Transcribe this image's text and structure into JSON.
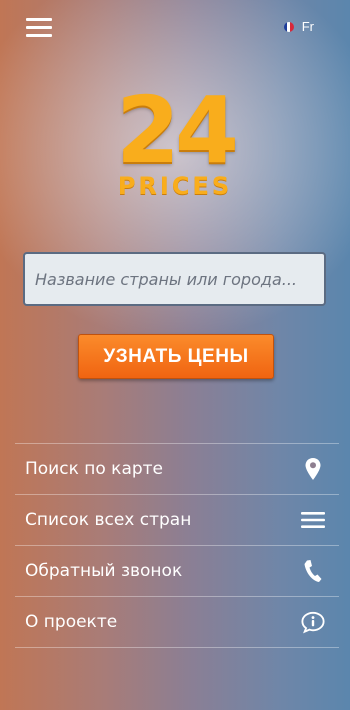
{
  "header": {
    "language": "Fr",
    "flag_colors": [
      "#1d3d9a",
      "#ffffff",
      "#d8283a"
    ]
  },
  "logo": {
    "number": "24",
    "word": "PRICES",
    "color": "#f9ad1c"
  },
  "search": {
    "placeholder": "Название страны или города..."
  },
  "cta": {
    "label": "УЗНАТЬ ЦЕНЫ",
    "color": "#f47419"
  },
  "menu": {
    "items": [
      {
        "label": "Поиск по карте",
        "icon": "map-pin-icon"
      },
      {
        "label": "Список всех стран",
        "icon": "list-icon"
      },
      {
        "label": "Обратный звонок",
        "icon": "phone-icon"
      },
      {
        "label": "О проекте",
        "icon": "info-bubble-icon"
      }
    ]
  }
}
